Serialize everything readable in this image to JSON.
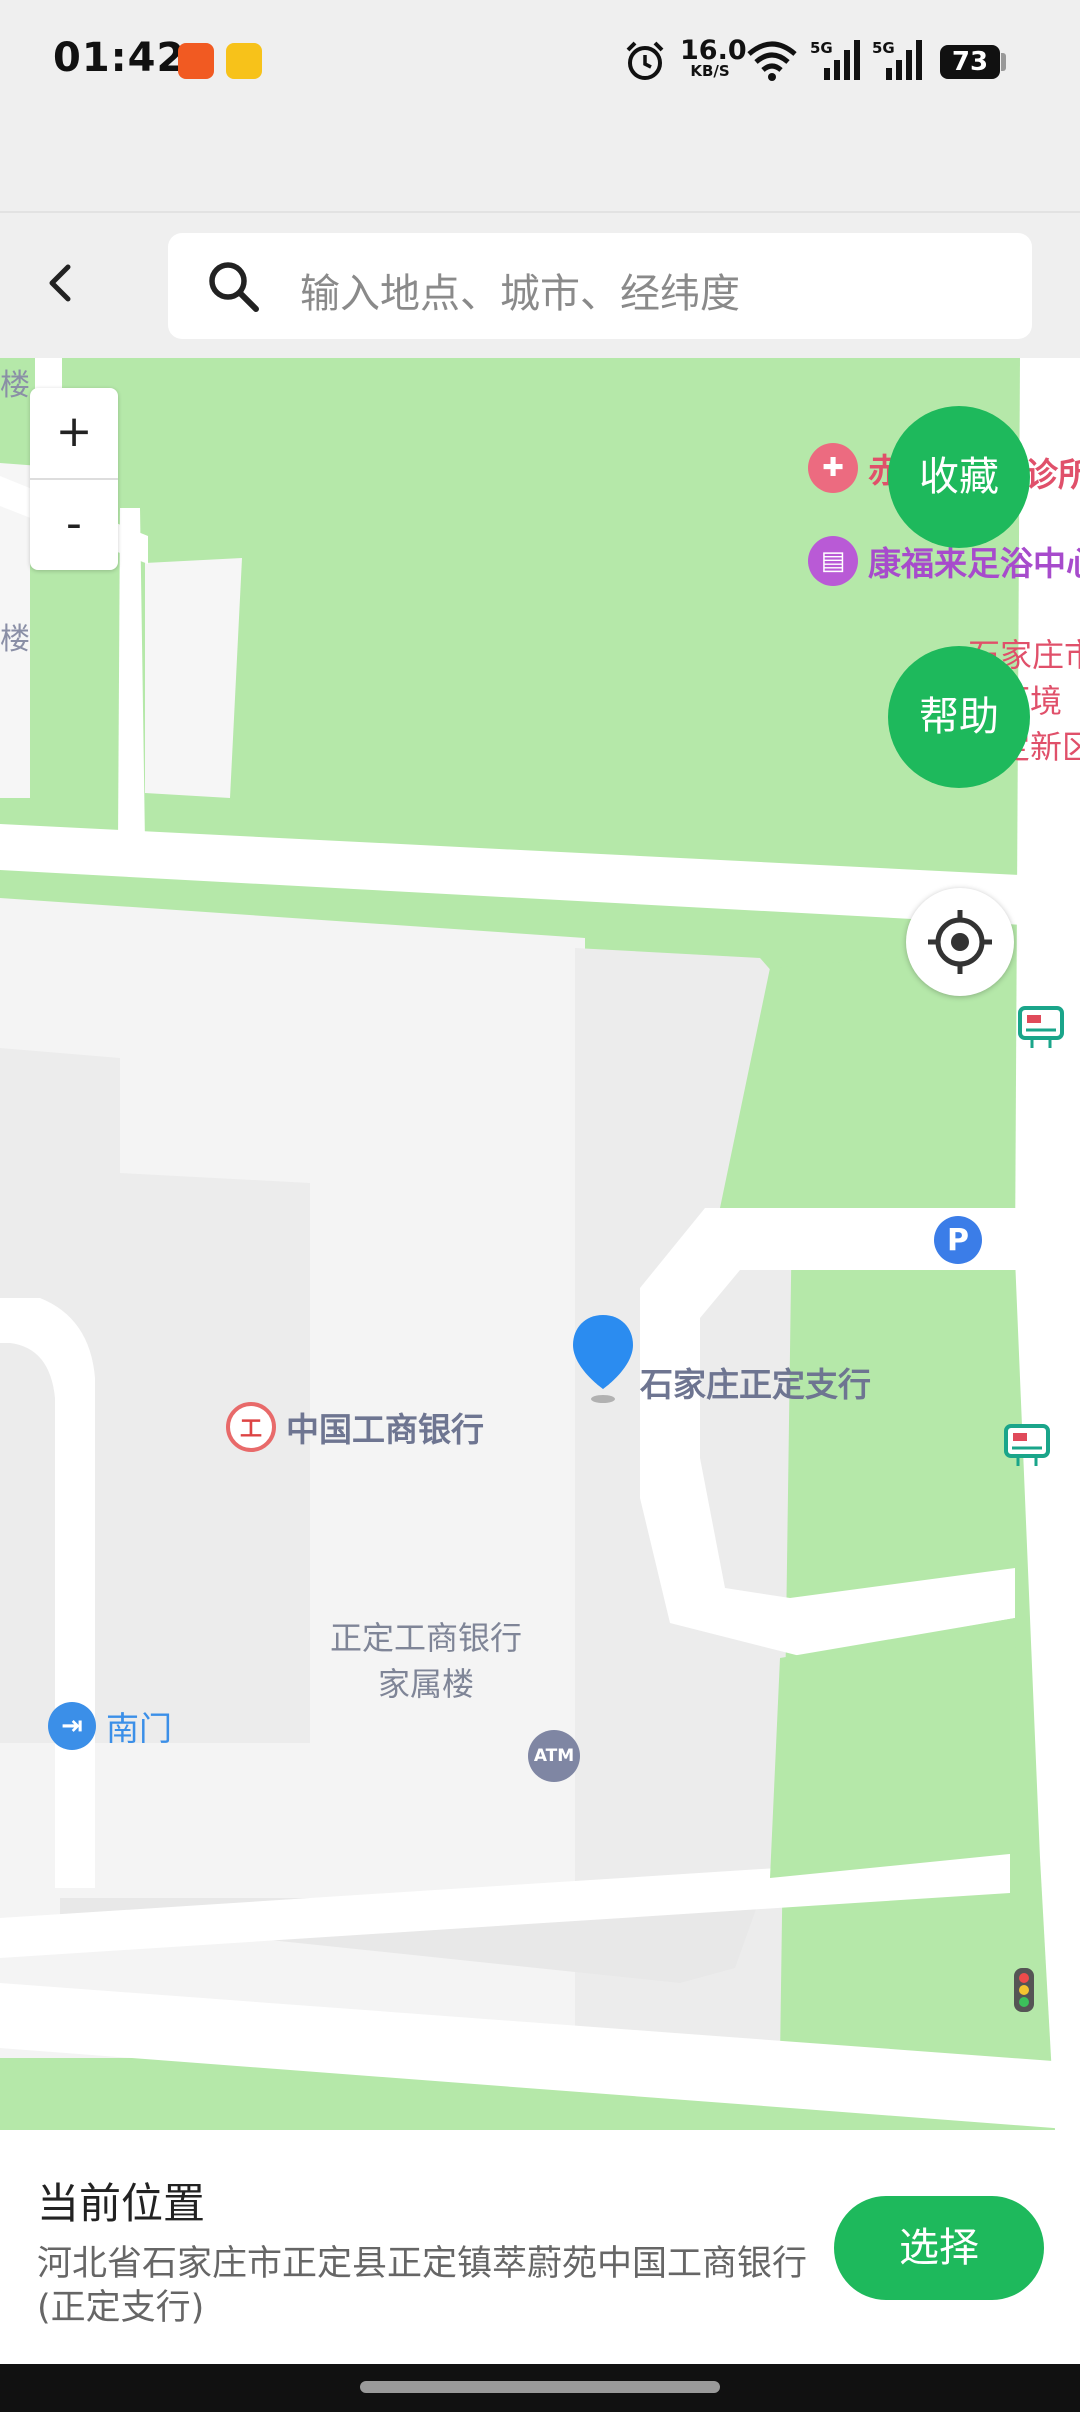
{
  "status_bar": {
    "time": "01:42",
    "speed_value": "16.0",
    "speed_unit": "KB/S",
    "battery": "73",
    "icons": [
      "kuaishou-app-icon",
      "clipboard-app-icon",
      "alarm-icon",
      "wifi-icon",
      "signal-5g-icon",
      "signal-5g-icon"
    ]
  },
  "search": {
    "placeholder": "输入地点、城市、经纬度"
  },
  "map": {
    "zoom_in_label": "+",
    "zoom_out_label": "-",
    "favorite_label": "收藏",
    "help_label": "帮助",
    "pois": {
      "clinic": "赤",
      "clinic_tail": "诊所",
      "foot_spa": "康福来足浴中心",
      "env_office_1": "石家庄市",
      "env_office_2": "环境",
      "env_office_3": "定新区",
      "bank_branch": "石家庄正定支行",
      "icbc": "中国工商银行",
      "housing_1": "正定工商银行",
      "housing_2": "家属楼",
      "south_gate": "南门",
      "atm": "ATM",
      "parking": "P",
      "building_left_top": "楼",
      "building_left_mid": "楼"
    },
    "colors": {
      "green_area": "#b5e8a9",
      "road": "#ffffffff",
      "building": "#f5f5f5",
      "pin": "#2b8cf0",
      "accent": "#1eb95c"
    }
  },
  "bottom_panel": {
    "title": "当前位置",
    "address": "河北省石家庄市正定县正定镇萃蔚苑中国工商银行(正定支行)",
    "select_label": "选择"
  }
}
